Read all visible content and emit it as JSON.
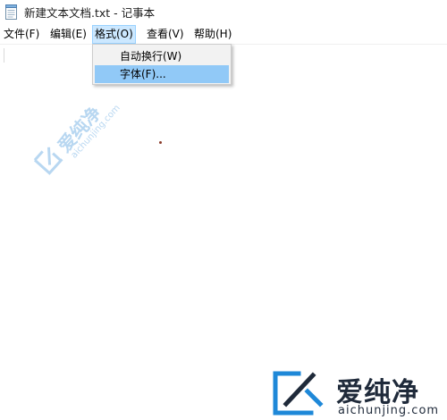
{
  "window": {
    "title": "新建文本文档.txt - 记事本",
    "icon": "notepad-icon"
  },
  "menubar": {
    "items": [
      {
        "label": "文件(F)"
      },
      {
        "label": "编辑(E)"
      },
      {
        "label": "格式(O)"
      },
      {
        "label": "查看(V)"
      },
      {
        "label": "帮助(H)"
      }
    ],
    "active_index": 2
  },
  "format_menu": {
    "items": [
      {
        "label": "自动换行(W)"
      },
      {
        "label": "字体(F)..."
      }
    ],
    "highlighted_index": 1
  },
  "watermarks": {
    "diagonal": {
      "name": "爱纯净",
      "url": "aichunjing.com"
    },
    "corner": {
      "name": "爱纯净",
      "url": "aichunjing.com"
    }
  },
  "colors": {
    "menu_active_bg": "#cce8ff",
    "menu_active_border": "#99d1ff",
    "dropdown_bg": "#f2f2f2",
    "dropdown_highlight": "#91c9f7",
    "watermark_blue": "#7fb7e6",
    "corner_logo_blue": "#1e88d8",
    "corner_text": "#1f2a3a"
  }
}
